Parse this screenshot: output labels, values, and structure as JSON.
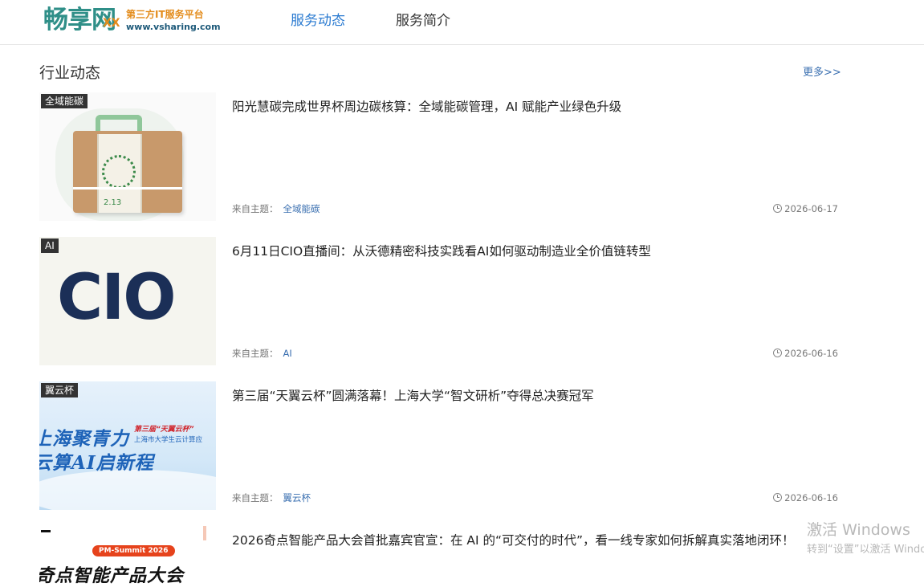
{
  "header": {
    "logo_text": "畅享网",
    "logo_mark": "XX",
    "logo_tagline": "第三方IT服务平台",
    "logo_url": "www.vsharing.com",
    "nav": [
      {
        "label": "服务动态",
        "active": true
      },
      {
        "label": "服务简介",
        "active": false
      }
    ]
  },
  "section": {
    "title": "行业动态",
    "more": "更多>>"
  },
  "articles": [
    {
      "tag": "全域能碳",
      "title": "阳光慧碳完成世界杯周边碳核算：全域能碳管理，AI 赋能产业绿色升级",
      "meta_prefix": "来自主题：",
      "topic": "全域能碳",
      "date": "2026-06-17",
      "thumb_icon": "product-box-image",
      "thumb_text": "2.13"
    },
    {
      "tag": "AI",
      "title": "6月11日CIO直播间：从沃德精密科技实践看AI如何驱动制造业全价值链转型",
      "meta_prefix": "来自主题：",
      "topic": "AI",
      "date": "2026-06-16",
      "thumb_icon": "cio-logo-image",
      "thumb_text": "CIO"
    },
    {
      "tag": "翼云杯",
      "title": "第三届“天翼云杯”圆满落幕！上海大学“智文研析”夺得总决赛冠军",
      "meta_prefix": "来自主题：",
      "topic": "翼云杯",
      "date": "2026-06-16",
      "thumb_icon": "contest-banner-image",
      "thumb_line1": "上海聚青力",
      "thumb_line2": "云算AI启新程",
      "thumb_small1": "第三届“天翼云杯”",
      "thumb_small2": "上海市大学生云计算应"
    },
    {
      "tag": "",
      "title": "2026奇点智能产品大会首批嘉宾官宣：在 AI 的“可交付的时代”，看一线专家如何拆解真实落地闭环！",
      "thumb_icon": "summit-banner-image",
      "thumb_pill": "PM-Summit 2026",
      "thumb_big": "奇点智能产品大会"
    }
  ],
  "watermark": {
    "line1": "激活 Windows",
    "line2": "转到“设置”以激活 Windows。"
  },
  "colors": {
    "accent": "#2b7bd1",
    "link": "#3a6fb0",
    "tag_bg": "#333333"
  }
}
